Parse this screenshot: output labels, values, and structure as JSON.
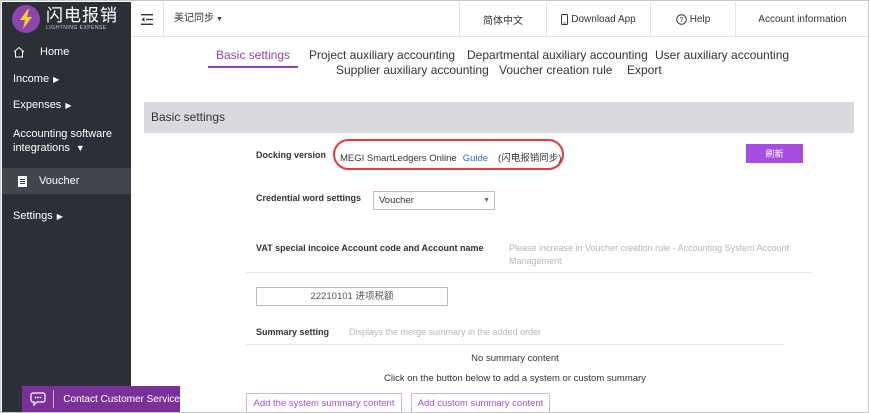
{
  "brand": {
    "name_cn": "闪电报销",
    "name_en": "LIGHTNING EXPENSE",
    "accent": "#8e44ad"
  },
  "sidebar": {
    "home": "Home",
    "income": "Income",
    "expenses": "Expenses",
    "accounting_line1": "Accounting software",
    "accounting_line2": "integrations",
    "voucher": "Voucher",
    "settings": "Settings"
  },
  "topbar": {
    "company": "美记同步",
    "language": "简体中文",
    "download": "Download App",
    "help": "Help",
    "account": "Account information"
  },
  "tabs": [
    "Basic settings",
    "Project auxiliary accounting",
    "Departmental auxiliary accounting",
    "User auxiliary accounting",
    "Supplier auxiliary accounting",
    "Voucher creation rule",
    "Export"
  ],
  "card": {
    "title": "Basic settings",
    "docking_label": "Docking version",
    "docking_value": "MEGI SmartLedgers Online",
    "guide": "Guide",
    "sync_note": "(闪电报销同步)",
    "refresh": "刷新",
    "credential_label": "Credential word settings",
    "credential_value": "Voucher",
    "vat_label": "VAT special incoice Account code and Account name",
    "vat_hint": "Please increase in Voucher creation rule - Accounting System Account Management",
    "vat_value": "22210101 进项税额",
    "summary_label": "Summary setting",
    "summary_hint": "Displays the merge summary in the added order",
    "no_summary": "No summary content",
    "click_hint": "Click on the button below to add a system or custom summary",
    "add_system": "Add the system summary content",
    "add_custom": "Add custom summary content"
  },
  "support": {
    "label": "Contact Customer Service"
  }
}
